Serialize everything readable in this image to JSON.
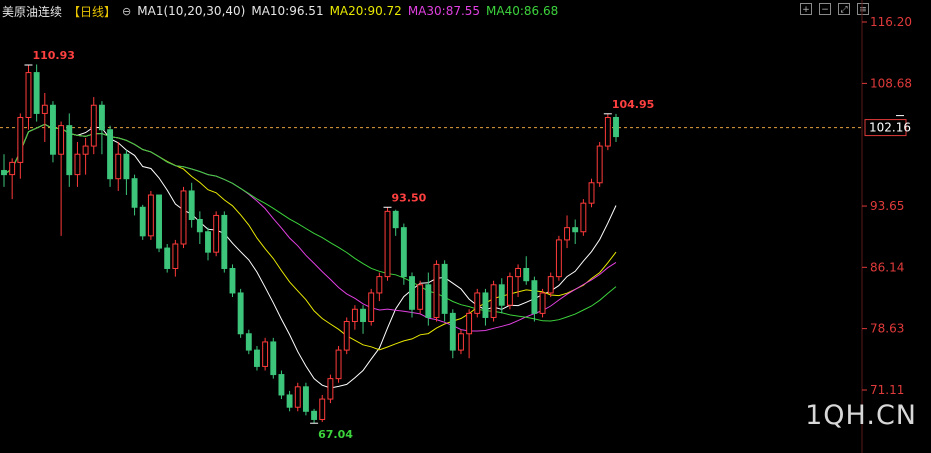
{
  "header": {
    "title": "美原油连续",
    "period": "【日线】",
    "ma1": "MA1(10,20,30,40)",
    "ma10": "MA10:96.51",
    "ma20": "MA20:90.72",
    "ma30": "MA30:87.55",
    "ma40": "MA40:86.68"
  },
  "toolbar": {
    "icons": [
      "zoom-in-icon",
      "zoom-out-icon",
      "expand-icon",
      "settings-icon"
    ]
  },
  "watermark": "1QH.CN",
  "colors": {
    "up": "#ff3b3b",
    "down": "#3cc57b",
    "ma10": "#ffffff",
    "ma20": "#e8e800",
    "ma30": "#e040e0",
    "ma40": "#3cd23c",
    "axis": "#e03a3a"
  },
  "chart_data": {
    "type": "candlestick",
    "ylim": [
      67.04,
      116.2
    ],
    "yticks": [
      "116.20",
      "108.68",
      "93.65",
      "86.14",
      "78.63",
      "71.11"
    ],
    "current_price": "102.16",
    "annotations": {
      "high1": "110.93",
      "low1": "67.04",
      "mid_high": "93.50",
      "high2": "104.95"
    },
    "candles": [
      [
        98.0,
        100.0,
        96.0,
        97.5
      ],
      [
        97.5,
        99.5,
        94.5,
        99.0
      ],
      [
        99.0,
        105.0,
        97.0,
        104.5
      ],
      [
        104.5,
        110.93,
        103.0,
        110.0
      ],
      [
        110.0,
        111.0,
        104.0,
        105.0
      ],
      [
        105.0,
        107.5,
        101.5,
        106.0
      ],
      [
        106.0,
        106.5,
        99.0,
        100.0
      ],
      [
        100.0,
        104.0,
        90.0,
        103.5
      ],
      [
        103.5,
        105.0,
        96.0,
        97.5
      ],
      [
        97.5,
        101.5,
        96.0,
        100.0
      ],
      [
        100.0,
        102.0,
        97.5,
        101.0
      ],
      [
        101.0,
        107.0,
        100.0,
        106.0
      ],
      [
        106.0,
        106.5,
        100.0,
        103.0
      ],
      [
        103.0,
        103.5,
        96.0,
        97.0
      ],
      [
        97.0,
        101.5,
        95.5,
        100.0
      ],
      [
        100.0,
        100.5,
        95.0,
        97.0
      ],
      [
        97.0,
        97.5,
        92.5,
        93.5
      ],
      [
        93.5,
        93.8,
        89.5,
        90.0
      ],
      [
        90.0,
        95.5,
        89.5,
        95.0
      ],
      [
        95.0,
        95.0,
        88.0,
        88.5
      ],
      [
        88.5,
        89.0,
        85.5,
        86.0
      ],
      [
        86.0,
        89.5,
        85.0,
        89.0
      ],
      [
        89.0,
        96.0,
        88.5,
        95.5
      ],
      [
        95.5,
        96.5,
        91.0,
        92.0
      ],
      [
        92.0,
        93.0,
        89.0,
        90.5
      ],
      [
        90.5,
        91.0,
        87.0,
        88.0
      ],
      [
        88.0,
        93.0,
        87.5,
        92.5
      ],
      [
        92.5,
        93.0,
        85.5,
        86.0
      ],
      [
        86.0,
        86.5,
        82.5,
        83.0
      ],
      [
        83.0,
        83.5,
        77.5,
        78.0
      ],
      [
        78.0,
        78.5,
        75.5,
        76.0
      ],
      [
        76.0,
        76.5,
        73.5,
        74.0
      ],
      [
        74.0,
        77.5,
        73.5,
        77.0
      ],
      [
        77.0,
        77.5,
        72.5,
        73.0
      ],
      [
        73.0,
        73.5,
        70.0,
        70.5
      ],
      [
        70.5,
        71.0,
        68.5,
        69.0
      ],
      [
        69.0,
        72.0,
        68.5,
        71.5
      ],
      [
        71.5,
        72.0,
        68.0,
        68.5
      ],
      [
        68.5,
        68.8,
        67.04,
        67.5
      ],
      [
        67.5,
        70.5,
        67.2,
        70.0
      ],
      [
        70.0,
        73.0,
        69.5,
        72.5
      ],
      [
        72.5,
        76.5,
        72.0,
        76.0
      ],
      [
        76.0,
        80.0,
        75.5,
        79.5
      ],
      [
        79.5,
        81.5,
        78.5,
        81.0
      ],
      [
        81.0,
        81.5,
        78.0,
        79.5
      ],
      [
        79.5,
        83.5,
        79.0,
        83.0
      ],
      [
        83.0,
        85.5,
        82.0,
        85.0
      ],
      [
        85.0,
        93.5,
        84.5,
        93.0
      ],
      [
        93.0,
        93.2,
        90.0,
        91.0
      ],
      [
        91.0,
        91.5,
        84.0,
        85.0
      ],
      [
        85.0,
        85.5,
        80.0,
        81.0
      ],
      [
        81.0,
        84.5,
        80.5,
        84.0
      ],
      [
        84.0,
        85.5,
        79.0,
        80.0
      ],
      [
        80.0,
        87.0,
        79.5,
        86.5
      ],
      [
        86.5,
        87.0,
        79.5,
        80.5
      ],
      [
        80.5,
        81.0,
        75.0,
        76.0
      ],
      [
        76.0,
        78.5,
        75.5,
        78.0
      ],
      [
        78.0,
        81.0,
        75.0,
        80.5
      ],
      [
        80.5,
        83.5,
        80.0,
        83.0
      ],
      [
        83.0,
        83.5,
        79.0,
        80.0
      ],
      [
        80.0,
        84.5,
        79.5,
        84.0
      ],
      [
        84.0,
        84.8,
        80.5,
        81.5
      ],
      [
        81.5,
        85.5,
        81.0,
        85.0
      ],
      [
        85.0,
        86.5,
        82.5,
        86.0
      ],
      [
        86.0,
        87.5,
        84.0,
        84.5
      ],
      [
        84.5,
        85.0,
        79.5,
        80.5
      ],
      [
        80.5,
        83.5,
        80.0,
        83.0
      ],
      [
        83.0,
        85.5,
        82.5,
        85.0
      ],
      [
        85.0,
        90.0,
        84.5,
        89.5
      ],
      [
        89.5,
        92.5,
        88.5,
        91.0
      ],
      [
        91.0,
        92.0,
        89.0,
        90.5
      ],
      [
        90.5,
        94.5,
        90.0,
        94.0
      ],
      [
        94.0,
        97.0,
        93.5,
        96.5
      ],
      [
        96.5,
        101.5,
        96.0,
        101.0
      ],
      [
        101.0,
        104.95,
        100.5,
        104.5
      ],
      [
        104.5,
        104.95,
        101.5,
        102.16
      ]
    ]
  }
}
